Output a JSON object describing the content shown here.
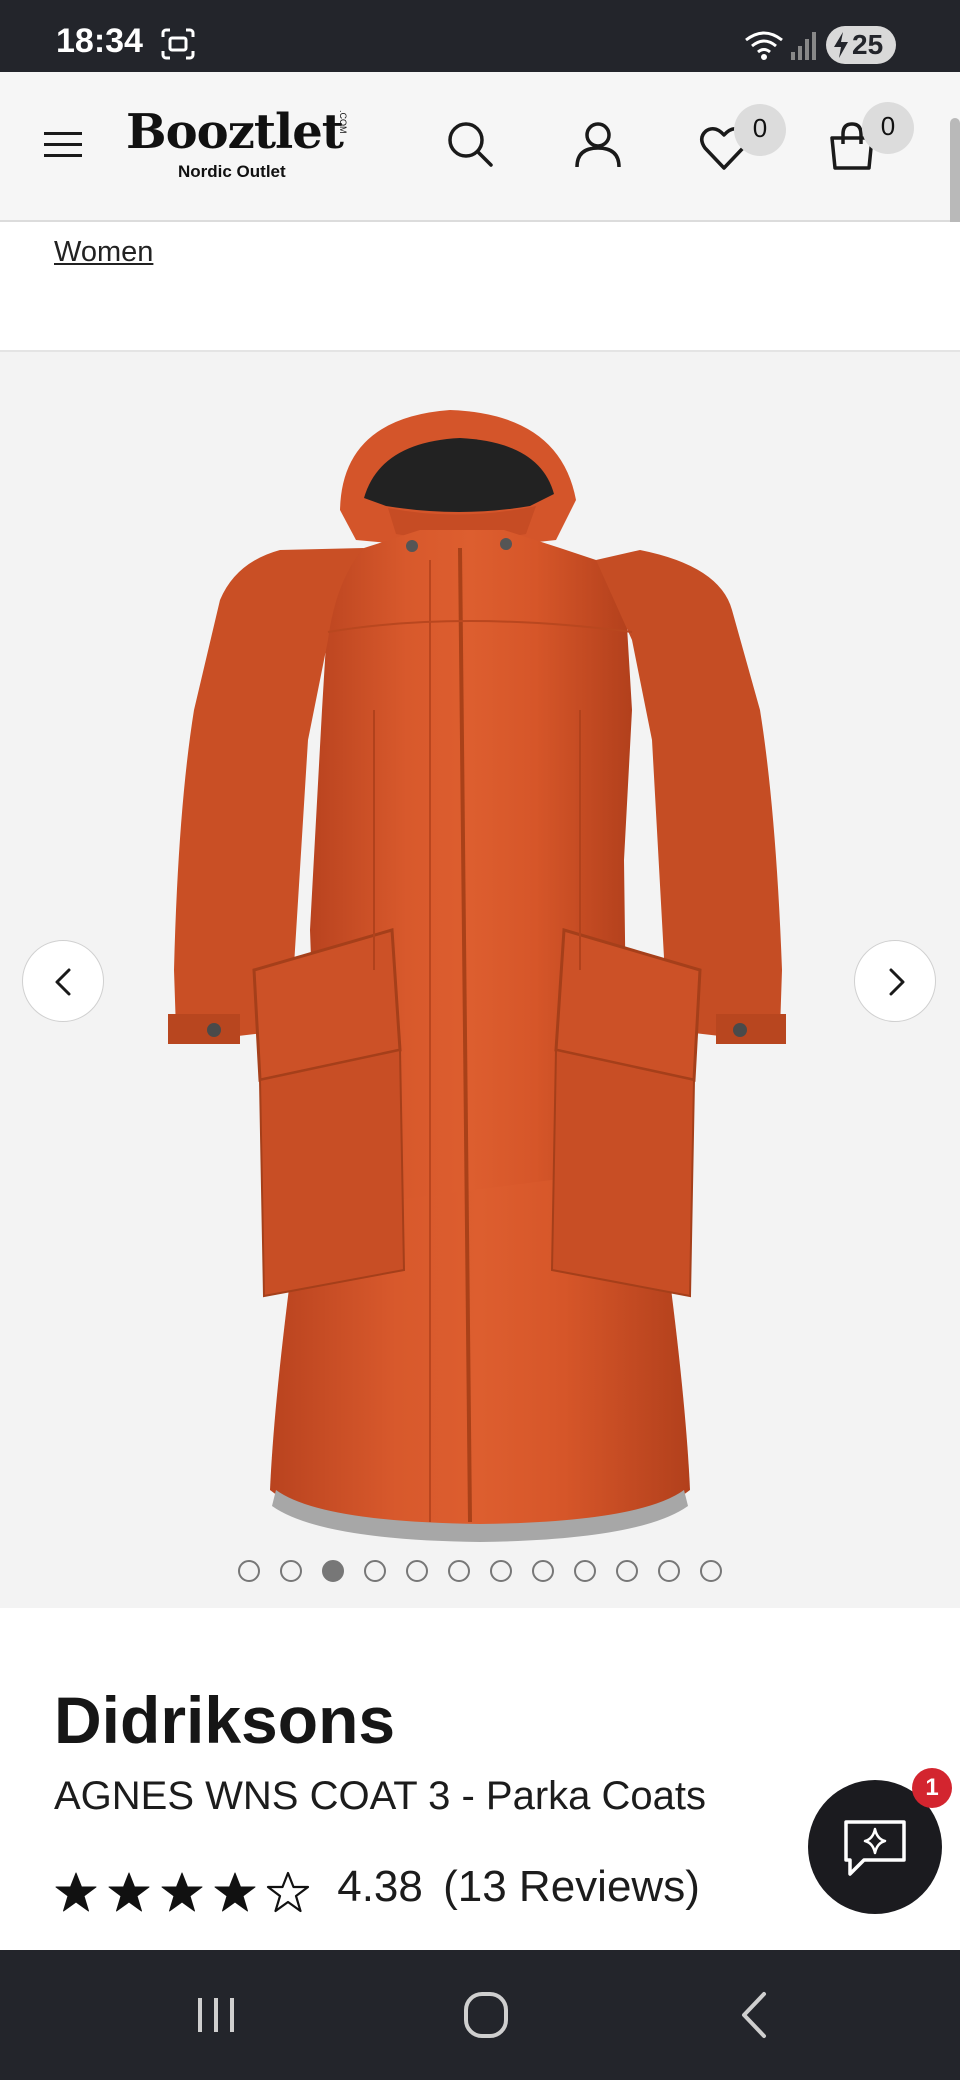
{
  "status_bar": {
    "time": "18:34",
    "battery": "25",
    "icons": [
      "screen-record-icon",
      "wifi-icon",
      "signal-icon",
      "battery-charging-icon"
    ]
  },
  "header": {
    "logo_main": "Booztlet",
    "logo_com": ".COM",
    "logo_sub": "Nordic Outlet",
    "wishlist_count": "0",
    "cart_count": "0",
    "icons": [
      "menu-icon",
      "search-icon",
      "account-icon",
      "heart-icon",
      "bag-icon"
    ]
  },
  "breadcrumb": {
    "label": "Women"
  },
  "gallery": {
    "image_alt": "Orange hooded parka coat",
    "image_count": 12,
    "active_index": 2
  },
  "product": {
    "brand": "Didriksons",
    "name": "AGNES WNS COAT 3 - Parka Coats",
    "rating": "4.38",
    "rating_value": 4.38,
    "rating_max": 5,
    "reviews_label": "(13 Reviews)"
  },
  "chat": {
    "badge_count": "1"
  },
  "colors": {
    "status_bar": "#23252b",
    "header_bg": "#f6f6f6",
    "gallery_bg": "#f3f3f3",
    "coat_orange": "#d2542a",
    "badge_red": "#d3252f"
  }
}
